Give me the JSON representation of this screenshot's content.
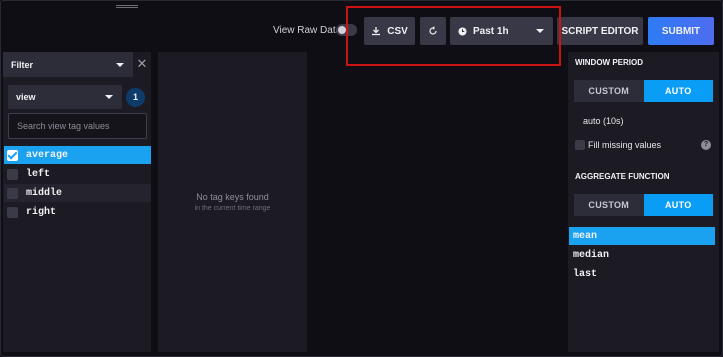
{
  "toolbar": {
    "raw_data_label": "View Raw Data",
    "csv_label": "CSV",
    "time_range": "Past 1h",
    "script_editor_label": "SCRIPT EDITOR",
    "submit_label": "SUBMIT"
  },
  "filter_panel": {
    "header": "Filter",
    "tag_key": "view",
    "selected_count": "1",
    "search_placeholder": "Search view tag values",
    "values": [
      {
        "label": "average",
        "checked": true
      },
      {
        "label": "left",
        "checked": false
      },
      {
        "label": "middle",
        "checked": false
      },
      {
        "label": "right",
        "checked": false
      }
    ]
  },
  "empty_panel": {
    "title": "No tag keys found",
    "subtitle": "in the current time range"
  },
  "right_panel": {
    "window_period_title": "WINDOW PERIOD",
    "custom_label": "CUSTOM",
    "auto_label": "AUTO",
    "auto_value": "auto (10s)",
    "fill_missing_label": "Fill missing values",
    "aggregate_title": "AGGREGATE FUNCTION",
    "functions": [
      {
        "label": "mean",
        "selected": true
      },
      {
        "label": "median",
        "selected": false
      },
      {
        "label": "last",
        "selected": false
      }
    ]
  },
  "colors": {
    "accent": "#1aa2f0",
    "highlight_box": "#cc1212",
    "submit_gradient_start": "#2e7bf5"
  }
}
